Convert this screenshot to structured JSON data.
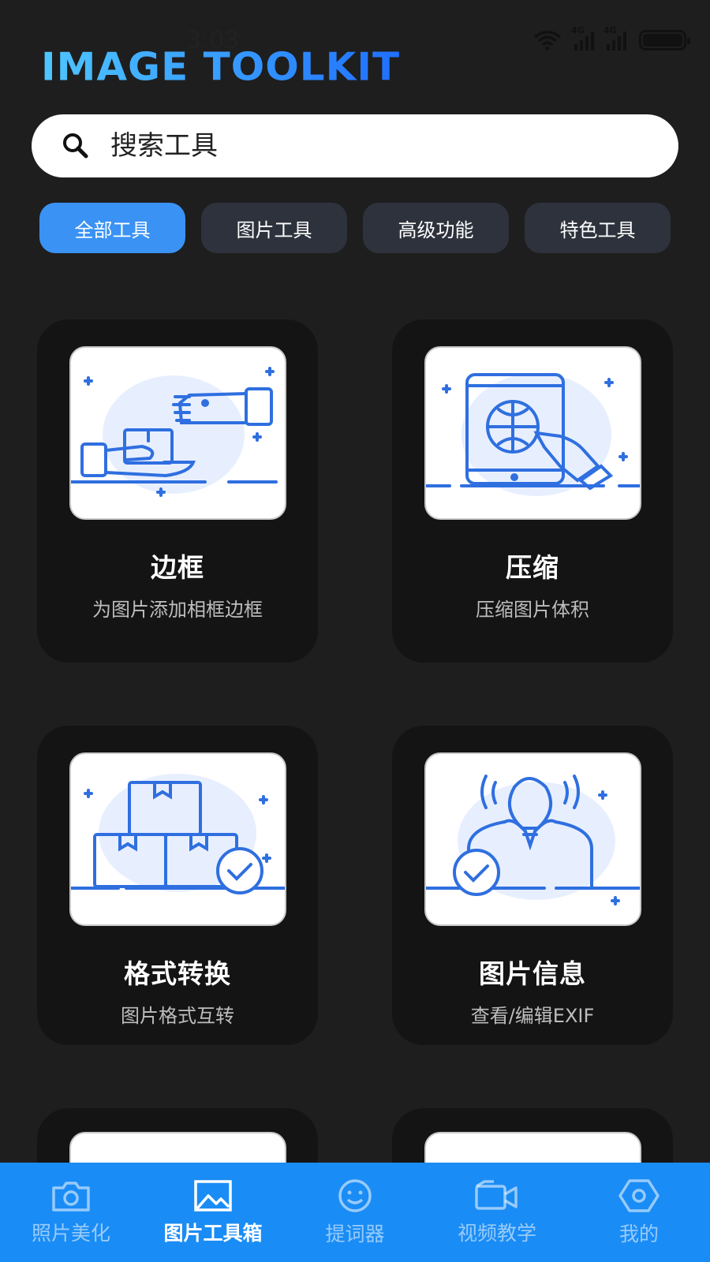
{
  "status": {
    "time": "3:03"
  },
  "app": {
    "logo": "IMAGE TOOLKIT"
  },
  "search": {
    "placeholder": "搜索工具"
  },
  "categories": [
    {
      "label": "全部工具",
      "active": true
    },
    {
      "label": "图片工具",
      "active": false
    },
    {
      "label": "高级功能",
      "active": false
    },
    {
      "label": "特色工具",
      "active": false
    }
  ],
  "tools": [
    {
      "title": "边框",
      "desc": "为图片添加相框边框",
      "icon": "hand-over-box-illustration"
    },
    {
      "title": "压缩",
      "desc": "压缩图片体积",
      "icon": "tablet-globe-touch-illustration"
    },
    {
      "title": "格式转换",
      "desc": "图片格式互转",
      "icon": "stacked-boxes-check-illustration"
    },
    {
      "title": "图片信息",
      "desc": "查看/编辑EXIF",
      "icon": "lightbulb-person-check-illustration"
    }
  ],
  "bottom_nav": [
    {
      "label": "照片美化",
      "icon": "camera-icon",
      "active": false
    },
    {
      "label": "图片工具箱",
      "icon": "image-icon",
      "active": true
    },
    {
      "label": "提词器",
      "icon": "smiley-icon",
      "active": false
    },
    {
      "label": "视频教学",
      "icon": "video-camera-icon",
      "active": false
    },
    {
      "label": "我的",
      "icon": "hexagon-icon",
      "active": false
    }
  ],
  "colors": {
    "accent": "#3a92f4",
    "nav_bg": "#1a8cf5",
    "card_bg": "#141414",
    "page_bg": "#1e1e1e",
    "chip_bg": "#2e323c"
  }
}
